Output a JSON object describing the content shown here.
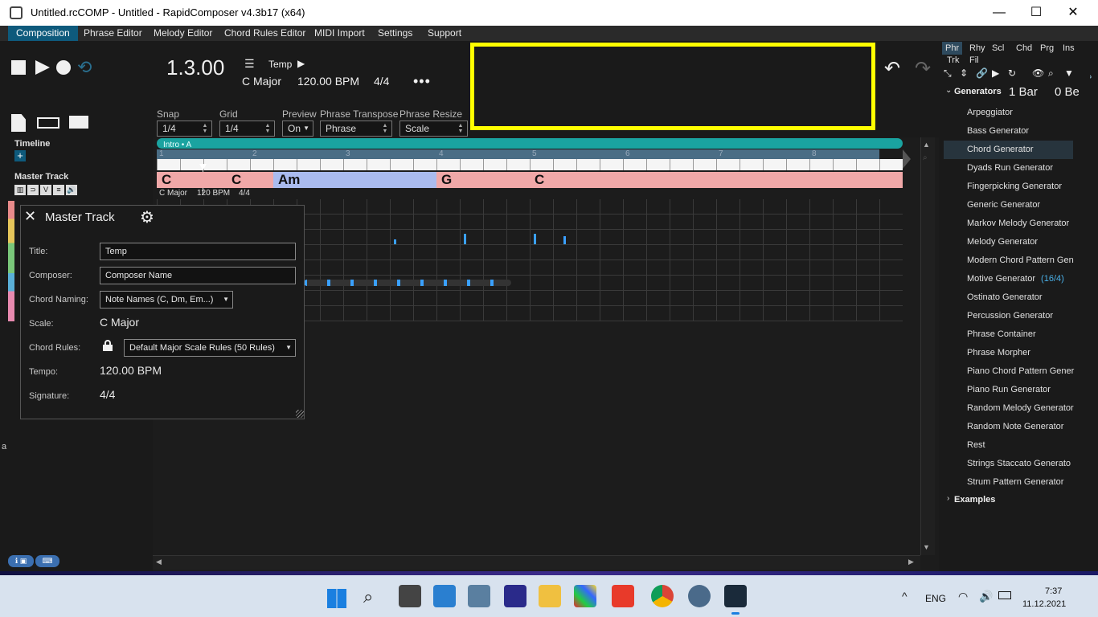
{
  "window": {
    "title": "Untitled.rcCOMP - Untitled - RapidComposer v4.3b17 (x64)",
    "minimize": "—",
    "maximize": "☐",
    "close": "✕"
  },
  "menu": [
    "Composition",
    "Phrase Editor",
    "Melody Editor",
    "Chord Rules Editor",
    "MIDI Import",
    "Settings",
    "Support"
  ],
  "transport": {
    "position": "1.3.00",
    "song_title": "Temp",
    "key": "C Major",
    "tempo": "120.00 BPM",
    "signature": "4/4",
    "more": "•••"
  },
  "toolbar": {
    "snap_label": "Snap",
    "snap_value": "1/4",
    "grid_label": "Grid",
    "grid_value": "1/4",
    "preview_label": "Preview",
    "preview_value": "On",
    "transpose_label": "Phrase Transpose",
    "transpose_value": "Phrase",
    "resize_label": "Phrase Resize",
    "resize_value": "Scale"
  },
  "left": {
    "timeline_label": "Timeline",
    "add": "+",
    "master_track_label": "Master Track",
    "master_icons": [
      "▥",
      "⊃",
      "V",
      "≡",
      "🔊"
    ],
    "info_left": "a"
  },
  "timeline": {
    "section": "Intro • A",
    "bars": [
      "1",
      "2",
      "3",
      "4",
      "5",
      "6",
      "7",
      "8"
    ],
    "chords": [
      {
        "name": "C",
        "color": "#f0a0a0"
      },
      {
        "name": "C",
        "color": "#f0a0a0"
      },
      {
        "name": "Am",
        "color": "#a8b8f0"
      },
      {
        "name": "G",
        "color": "#f0a0a0"
      },
      {
        "name": "C",
        "color": "#f0a0a0"
      }
    ],
    "master_info": {
      "key": "C Major",
      "tempo": "120 BPM",
      "sig": "4/4"
    }
  },
  "dialog": {
    "title": "Master Track",
    "title_label": "Title:",
    "title_value": "Temp",
    "composer_label": "Composer:",
    "composer_value": "Composer Name",
    "naming_label": "Chord Naming:",
    "naming_value": "Note Names (C, Dm, Em...)",
    "scale_label": "Scale:",
    "scale_value": "C Major",
    "rules_label": "Chord Rules:",
    "rules_value": "Default Major Scale Rules (50 Rules)",
    "tempo_label": "Tempo:",
    "tempo_value": "120.00 BPM",
    "sig_label": "Signature:",
    "sig_value": "4/4"
  },
  "right": {
    "tabs_row1": [
      "Phr",
      "Rhy",
      "Scl",
      "Chd",
      "Prg",
      "Ins"
    ],
    "tabs_row2": [
      "Trk",
      "Fil"
    ],
    "generators_label": "Generators",
    "bar_count": "1 Bar",
    "beat_count": "0 Be",
    "generators": [
      "Arpeggiator",
      "Bass Generator",
      "Chord Generator",
      "Dyads Run Generator",
      "Fingerpicking Generator",
      "Generic Generator",
      "Markov Melody Generator",
      "Melody Generator",
      "Modern Chord Pattern Gen",
      "Motive Generator",
      "Ostinato Generator",
      "Percussion Generator",
      "Phrase Container",
      "Phrase Morpher",
      "Piano Chord Pattern Gener",
      "Piano Run Generator",
      "Random Melody Generator",
      "Random Note Generator",
      "Rest",
      "Strings Staccato Generato",
      "Strum Pattern Generator"
    ],
    "motive_extra": "(16/4)",
    "examples_label": "Examples"
  },
  "taskbar": {
    "lang": "ENG",
    "time": "7:37",
    "date": "11.12.2021"
  }
}
